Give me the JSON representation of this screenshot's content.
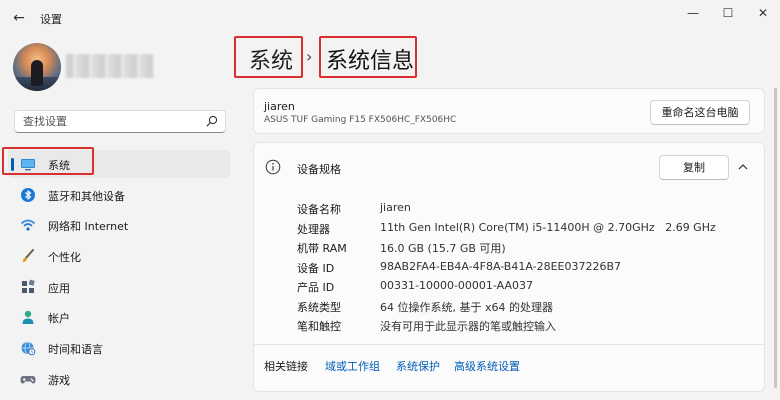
{
  "window": {
    "app_title": "设置",
    "back_glyph": "←",
    "minimize_glyph": "—",
    "maximize_glyph": "☐",
    "close_glyph": "✕"
  },
  "search": {
    "placeholder": "查找设置"
  },
  "sidebar": {
    "items": [
      {
        "label": "系统",
        "icon": "system-display-icon",
        "active": true
      },
      {
        "label": "蓝牙和其他设备",
        "icon": "bluetooth-icon",
        "active": false
      },
      {
        "label": "网络和 Internet",
        "icon": "wifi-icon",
        "active": false
      },
      {
        "label": "个性化",
        "icon": "brush-icon",
        "active": false
      },
      {
        "label": "应用",
        "icon": "apps-icon",
        "active": false
      },
      {
        "label": "帐户",
        "icon": "account-icon",
        "active": false
      },
      {
        "label": "时间和语言",
        "icon": "globe-clock-icon",
        "active": false
      },
      {
        "label": "游戏",
        "icon": "gamepad-icon",
        "active": false
      }
    ]
  },
  "breadcrumb": {
    "parent": "系统",
    "separator": "›",
    "current": "系统信息"
  },
  "device": {
    "name": "jiaren",
    "model": "ASUS TUF Gaming F15 FX506HC_FX506HC",
    "rename_button": "重命名这台电脑"
  },
  "specs": {
    "title": "设备规格",
    "copy_button": "复制",
    "rows": [
      {
        "label": "设备名称",
        "value": "jiaren"
      },
      {
        "label": "处理器",
        "value": "11th Gen Intel(R) Core(TM) i5-11400H @ 2.70GHz   2.69 GHz"
      },
      {
        "label": "机带 RAM",
        "value": "16.0 GB (15.7 GB 可用)"
      },
      {
        "label": "设备 ID",
        "value": "98AB2FA4-EB4A-4F8A-B41A-28EE037226B7"
      },
      {
        "label": "产品 ID",
        "value": "00331-10000-00001-AA037"
      },
      {
        "label": "系统类型",
        "value": "64 位操作系统, 基于 x64 的处理器"
      },
      {
        "label": "笔和触控",
        "value": "没有可用于此显示器的笔或触控输入"
      }
    ]
  },
  "related": {
    "label": "相关链接",
    "links": [
      "域或工作组",
      "系统保护",
      "高级系统设置"
    ]
  },
  "colors": {
    "accent": "#005fb8",
    "highlight": "#d9302f",
    "background": "#f3f3f3"
  }
}
